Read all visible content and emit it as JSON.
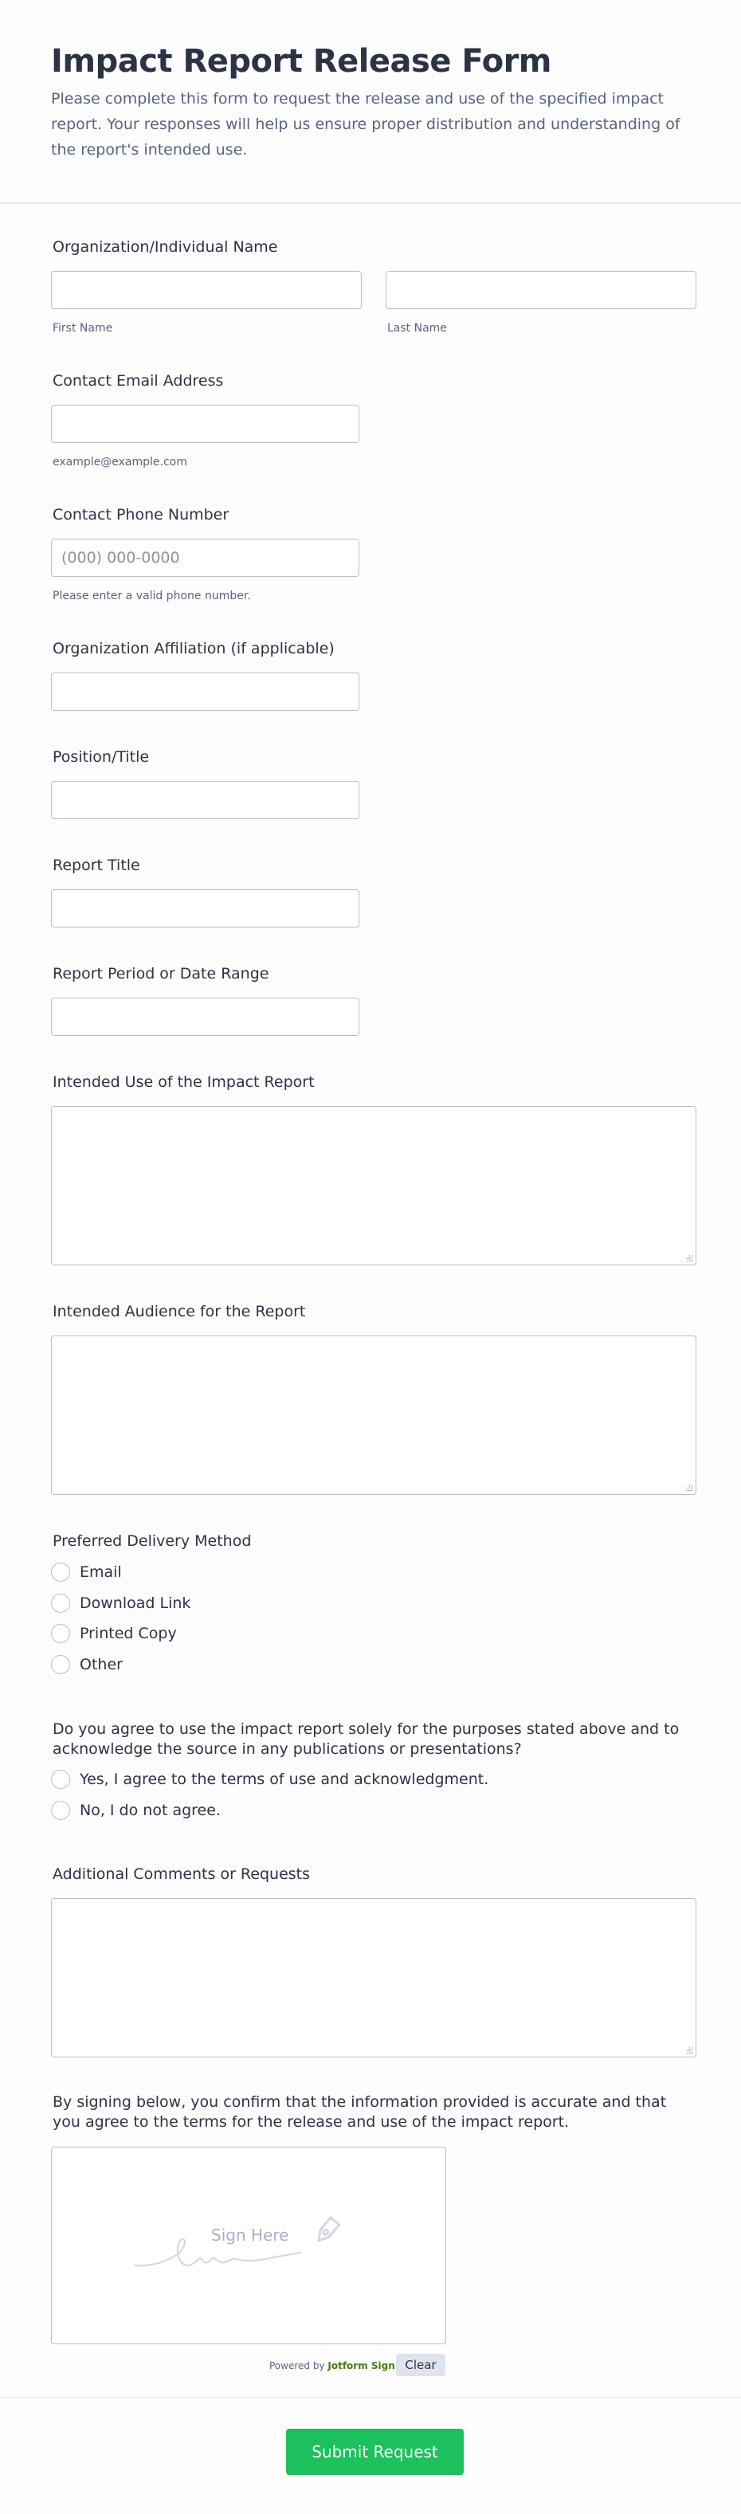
{
  "header": {
    "title": "Impact Report Release Form",
    "subtitle": "Please complete this form to request the release and use of the specified impact report. Your responses will help us ensure proper distribution and understanding of the report's intended use."
  },
  "fields": {
    "name": {
      "label": "Organization/Individual Name",
      "first_sublabel": "First Name",
      "last_sublabel": "Last Name"
    },
    "email": {
      "label": "Contact Email Address",
      "sublabel": "example@example.com"
    },
    "phone": {
      "label": "Contact Phone Number",
      "placeholder": "(000) 000-0000",
      "sublabel": "Please enter a valid phone number."
    },
    "affiliation": {
      "label": "Organization Affiliation (if applicable)"
    },
    "position": {
      "label": "Position/Title"
    },
    "report_title": {
      "label": "Report Title"
    },
    "report_period": {
      "label": "Report Period or Date Range"
    },
    "intended_use": {
      "label": "Intended Use of the Impact Report"
    },
    "intended_audience": {
      "label": "Intended Audience for the Report"
    },
    "delivery": {
      "label": "Preferred Delivery Method",
      "options": [
        "Email",
        "Download Link",
        "Printed Copy",
        "Other"
      ]
    },
    "agreement": {
      "label": "Do you agree to use the impact report solely for the purposes stated above and to acknowledge the source in any publications or presentations?",
      "options": [
        "Yes, I agree to the terms of use and acknowledgment.",
        "No, I do not agree."
      ]
    },
    "comments": {
      "label": "Additional Comments or Requests"
    },
    "signature": {
      "label": "By signing below, you confirm that the information provided is accurate and that you agree to the terms for the release and use of the impact report.",
      "placeholder": "Sign Here",
      "powered_prefix": "Powered by",
      "powered_brand": "Jotform Sign",
      "clear_label": "Clear"
    }
  },
  "submit_label": "Submit Request",
  "colors": {
    "accent": "#1cc05c",
    "text": "#2c3345",
    "muted": "#57647e",
    "border": "#b8bdc9"
  }
}
